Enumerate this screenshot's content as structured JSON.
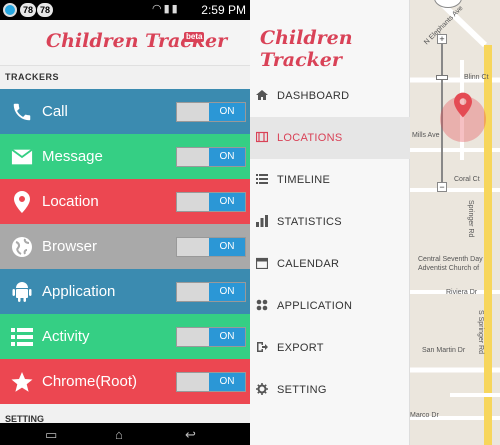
{
  "status_bar": {
    "badge_left": "78",
    "badge_mid": "78",
    "time": "2:59 PM"
  },
  "app": {
    "logo_text": "Children Tracker",
    "beta_label": "beta"
  },
  "trackers": {
    "section_label": "TRACKERS",
    "items": [
      {
        "label": "Call",
        "toggle": "ON",
        "color": "#3b8bb0",
        "icon": "phone-icon"
      },
      {
        "label": "Message",
        "toggle": "ON",
        "color": "#35cf84",
        "icon": "envelope-icon"
      },
      {
        "label": "Location",
        "toggle": "ON",
        "color": "#ec4751",
        "icon": "map-pin-icon"
      },
      {
        "label": "Browser",
        "toggle": "ON",
        "color": "#a9a9a9",
        "icon": "globe-icon"
      },
      {
        "label": "Application",
        "toggle": "ON",
        "color": "#3b8bb0",
        "icon": "android-icon"
      },
      {
        "label": "Activity",
        "toggle": "ON",
        "color": "#35cf84",
        "icon": "list-icon"
      },
      {
        "label": "Chrome(Root)",
        "toggle": "ON",
        "color": "#ec4751",
        "icon": "star-icon"
      }
    ]
  },
  "setting_section_label": "SETTING",
  "drawer": {
    "items": [
      {
        "label": "DASHBOARD",
        "icon": "home-icon",
        "active": false
      },
      {
        "label": "LOCATIONS",
        "icon": "map-icon",
        "active": true
      },
      {
        "label": "TIMELINE",
        "icon": "list-icon",
        "active": false
      },
      {
        "label": "STATISTICS",
        "icon": "bar-chart-icon",
        "active": false
      },
      {
        "label": "CALENDAR",
        "icon": "calendar-icon",
        "active": false
      },
      {
        "label": "APPLICATION",
        "icon": "grid-icon",
        "active": false
      },
      {
        "label": "EXPORT",
        "icon": "export-icon",
        "active": false
      },
      {
        "label": "SETTING",
        "icon": "gear-icon",
        "active": false
      }
    ]
  },
  "map": {
    "labels": {
      "n_phoenix": "N Elephants Ave",
      "blinn": "Blinn Ct",
      "mills": "Mills Ave",
      "coral": "Coral Ct",
      "springer_rd": "Springer Rd",
      "church": "Central Seventh Day Adventist Church of",
      "rivera": "Riviera Dr",
      "san_martin": "San Martin Dr",
      "s_springer": "S Springer Rd",
      "marco": "Marco Dr"
    },
    "zoom_in": "+",
    "zoom_out": "−",
    "colors": {
      "road_yellow": "#f7d65c",
      "road_white": "#ffffff",
      "pin": "#e44b54",
      "accent": "#d94257"
    }
  }
}
